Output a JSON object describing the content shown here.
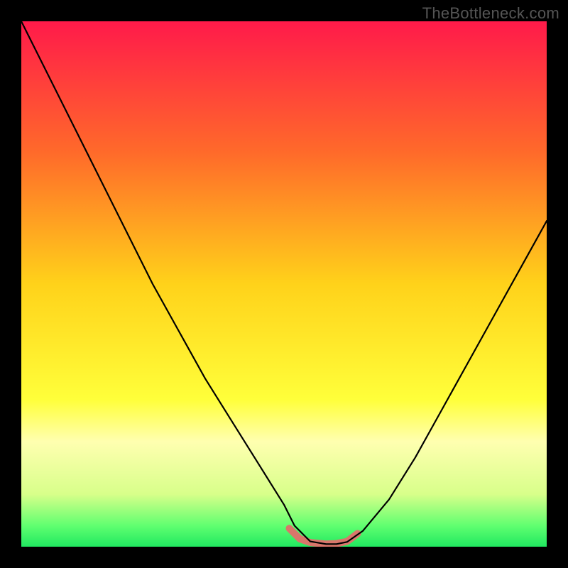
{
  "watermark": "TheBottleneck.com",
  "chart_data": {
    "type": "line",
    "title": "",
    "xlabel": "",
    "ylabel": "",
    "xlim": [
      0,
      100
    ],
    "ylim": [
      0,
      100
    ],
    "series": [
      {
        "name": "bottleneck-curve",
        "x": [
          0,
          5,
          10,
          15,
          20,
          25,
          30,
          35,
          40,
          45,
          50,
          52,
          55,
          58,
          60,
          62,
          65,
          70,
          75,
          80,
          85,
          90,
          95,
          100
        ],
        "values": [
          100,
          90,
          80,
          70,
          60,
          50,
          41,
          32,
          24,
          16,
          8,
          4,
          1,
          0.5,
          0.5,
          0.9,
          3,
          9,
          17,
          26,
          35,
          44,
          53,
          62
        ]
      },
      {
        "name": "optimal-range-band",
        "x": [
          51,
          53,
          55,
          58,
          60,
          62,
          64
        ],
        "values": [
          3.5,
          1.5,
          0.8,
          0.5,
          0.6,
          1.0,
          2.5
        ]
      }
    ],
    "gradient_stops": [
      {
        "pct": 0,
        "color": "#ff1a4a"
      },
      {
        "pct": 25,
        "color": "#ff6a2a"
      },
      {
        "pct": 50,
        "color": "#ffd21a"
      },
      {
        "pct": 72,
        "color": "#ffff3a"
      },
      {
        "pct": 80,
        "color": "#ffffb0"
      },
      {
        "pct": 90,
        "color": "#d8ff8a"
      },
      {
        "pct": 96,
        "color": "#60ff70"
      },
      {
        "pct": 100,
        "color": "#20e860"
      }
    ]
  }
}
